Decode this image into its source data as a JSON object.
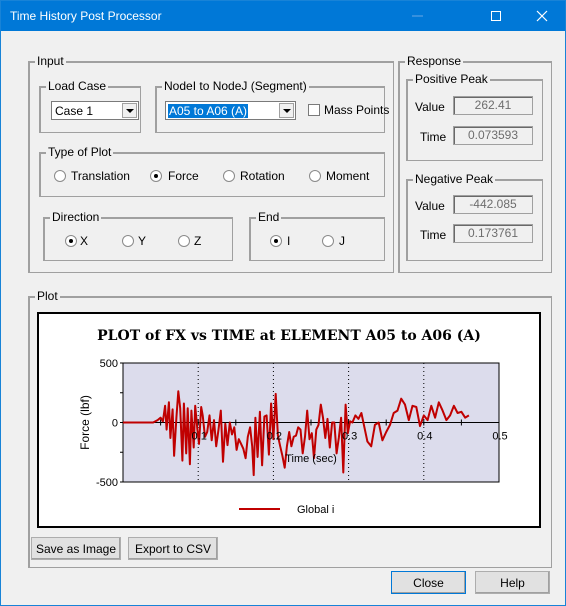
{
  "window": {
    "title": "Time History Post Processor",
    "controls": {
      "minimize": "minimize-icon",
      "maximize": "maximize-icon",
      "close": "close-icon"
    }
  },
  "input": {
    "label": "Input",
    "load_case": {
      "label": "Load Case",
      "value": "Case 1"
    },
    "segment": {
      "label": "NodeI to NodeJ (Segment)",
      "value": "A05 to A06 (A)"
    },
    "mass_points": {
      "label": "Mass Points",
      "checked": false
    },
    "type_of_plot": {
      "label": "Type of Plot",
      "options": [
        {
          "label": "Translation",
          "selected": false
        },
        {
          "label": "Force",
          "selected": true
        },
        {
          "label": "Rotation",
          "selected": false
        },
        {
          "label": "Moment",
          "selected": false
        }
      ]
    },
    "direction": {
      "label": "Direction",
      "options": [
        {
          "label": "X",
          "selected": true
        },
        {
          "label": "Y",
          "selected": false
        },
        {
          "label": "Z",
          "selected": false
        }
      ]
    },
    "end": {
      "label": "End",
      "options": [
        {
          "label": "I",
          "selected": true
        },
        {
          "label": "J",
          "selected": false
        }
      ]
    }
  },
  "response": {
    "label": "Response",
    "positive_peak": {
      "label": "Positive Peak",
      "value_label": "Value",
      "value": "262.41",
      "time_label": "Time",
      "time": "0.073593"
    },
    "negative_peak": {
      "label": "Negative Peak",
      "value_label": "Value",
      "value": "-442.085",
      "time_label": "Time",
      "time": "0.173761"
    }
  },
  "plot": {
    "label": "Plot",
    "save_image_label": "Save as Image",
    "export_csv_label": "Export to CSV"
  },
  "footer": {
    "close_label": "Close",
    "help_label": "Help"
  },
  "colors": {
    "titlebar": "#0078d7",
    "series": "#c00000",
    "plot_bg": "#dcdcec"
  },
  "chart_data": {
    "type": "line",
    "title": "PLOT of FX vs TIME at ELEMENT A05 to A06 (A)",
    "xlabel": "Time (sec)",
    "ylabel": "Force  (lbf)",
    "xlim": [
      0,
      0.5
    ],
    "ylim": [
      -500,
      500
    ],
    "x_ticks": [
      "0.1",
      "0.2",
      "0.3",
      "0.4",
      "0.5"
    ],
    "x_tick_values": [
      0.1,
      0.2,
      0.3,
      0.4,
      0.5
    ],
    "y_ticks": [
      "500",
      "0",
      "-500"
    ],
    "y_tick_values": [
      500,
      0,
      -500
    ],
    "grid": "vertical dotted at major x ticks",
    "legend": {
      "position": "bottom-center",
      "entries": [
        "Global  i"
      ]
    },
    "series": [
      {
        "name": "Global  i",
        "x": [
          0,
          0.02,
          0.04,
          0.046,
          0.05,
          0.053,
          0.056,
          0.058,
          0.061,
          0.063,
          0.066,
          0.068,
          0.071,
          0.0736,
          0.076,
          0.079,
          0.081,
          0.084,
          0.086,
          0.089,
          0.091,
          0.094,
          0.096,
          0.099,
          0.101,
          0.104,
          0.106,
          0.109,
          0.112,
          0.115,
          0.118,
          0.121,
          0.124,
          0.127,
          0.13,
          0.133,
          0.136,
          0.139,
          0.142,
          0.145,
          0.148,
          0.151,
          0.154,
          0.157,
          0.16,
          0.163,
          0.166,
          0.169,
          0.1718,
          0.1738,
          0.176,
          0.179,
          0.182,
          0.185,
          0.188,
          0.191,
          0.194,
          0.197,
          0.2,
          0.203,
          0.206,
          0.209,
          0.212,
          0.215,
          0.218,
          0.221,
          0.224,
          0.227,
          0.23,
          0.233,
          0.236,
          0.239,
          0.242,
          0.245,
          0.248,
          0.251,
          0.254,
          0.257,
          0.26,
          0.263,
          0.266,
          0.269,
          0.272,
          0.275,
          0.278,
          0.281,
          0.284,
          0.287,
          0.29,
          0.293,
          0.296,
          0.299,
          0.302,
          0.305,
          0.309,
          0.313,
          0.317,
          0.321,
          0.325,
          0.33,
          0.335,
          0.34,
          0.345,
          0.35,
          0.355,
          0.36,
          0.365,
          0.37,
          0.375,
          0.38,
          0.385,
          0.39,
          0.395,
          0.4,
          0.405,
          0.41,
          0.415,
          0.42,
          0.425,
          0.43,
          0.435,
          0.44,
          0.445,
          0.45,
          0.455,
          0.46
        ],
        "y": [
          0,
          0,
          0,
          20,
          40,
          10,
          140,
          -60,
          170,
          -130,
          110,
          -280,
          40,
          262,
          120,
          -320,
          160,
          -260,
          120,
          -350,
          100,
          -210,
          140,
          -60,
          -180,
          130,
          60,
          -120,
          -80,
          60,
          -150,
          20,
          -200,
          -60,
          100,
          -330,
          -10,
          -190,
          0,
          -100,
          -40,
          -230,
          -140,
          -180,
          -220,
          -300,
          -120,
          -40,
          -200,
          -442,
          40,
          -290,
          90,
          -360,
          50,
          60,
          -270,
          160,
          -140,
          240,
          -110,
          -200,
          -280,
          -380,
          -200,
          -80,
          -200,
          -120,
          -110,
          -40,
          -60,
          -260,
          -120,
          100,
          -140,
          -90,
          -300,
          -60,
          -20,
          150,
          40,
          -130,
          30,
          -210,
          0,
          0,
          -260,
          -130,
          40,
          -420,
          150,
          -90,
          10,
          0,
          60,
          30,
          80,
          -40,
          -160,
          -200,
          -20,
          0,
          -150,
          -80,
          -20,
          80,
          100,
          200,
          150,
          20,
          140,
          130,
          -30,
          60,
          20,
          140,
          40,
          170,
          100,
          20,
          60,
          140,
          80,
          90,
          40,
          60,
          240,
          160,
          40,
          180,
          230,
          40,
          60,
          200,
          130,
          -10,
          -60,
          80,
          60,
          -20,
          30,
          20,
          -40,
          -70,
          -90,
          -60,
          -40,
          -20,
          40
        ]
      }
    ]
  }
}
